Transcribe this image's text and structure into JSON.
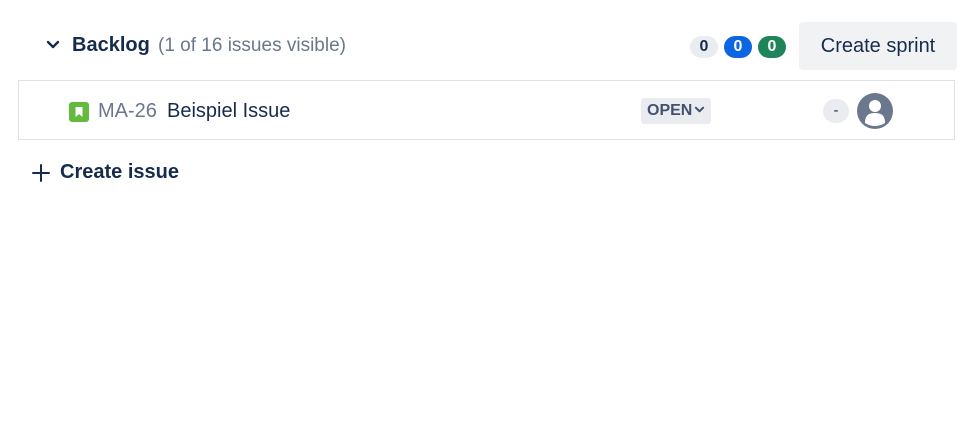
{
  "backlog": {
    "title": "Backlog",
    "count_text": "(1 of 16 issues visible)",
    "status_counts": {
      "todo": "0",
      "in_progress": "0",
      "done": "0"
    },
    "create_sprint_label": "Create sprint"
  },
  "issues": [
    {
      "key": "MA-26",
      "summary": "Beispiel Issue",
      "status": "OPEN",
      "estimate": "-",
      "type_icon": "story-icon",
      "assignee_icon": "avatar-placeholder-icon"
    }
  ],
  "create_issue_label": "Create issue",
  "colors": {
    "story": "#63ba3c",
    "in_progress_badge": "#0c66e4",
    "done_badge": "#1f845a",
    "todo_badge": "#ebecf0"
  }
}
